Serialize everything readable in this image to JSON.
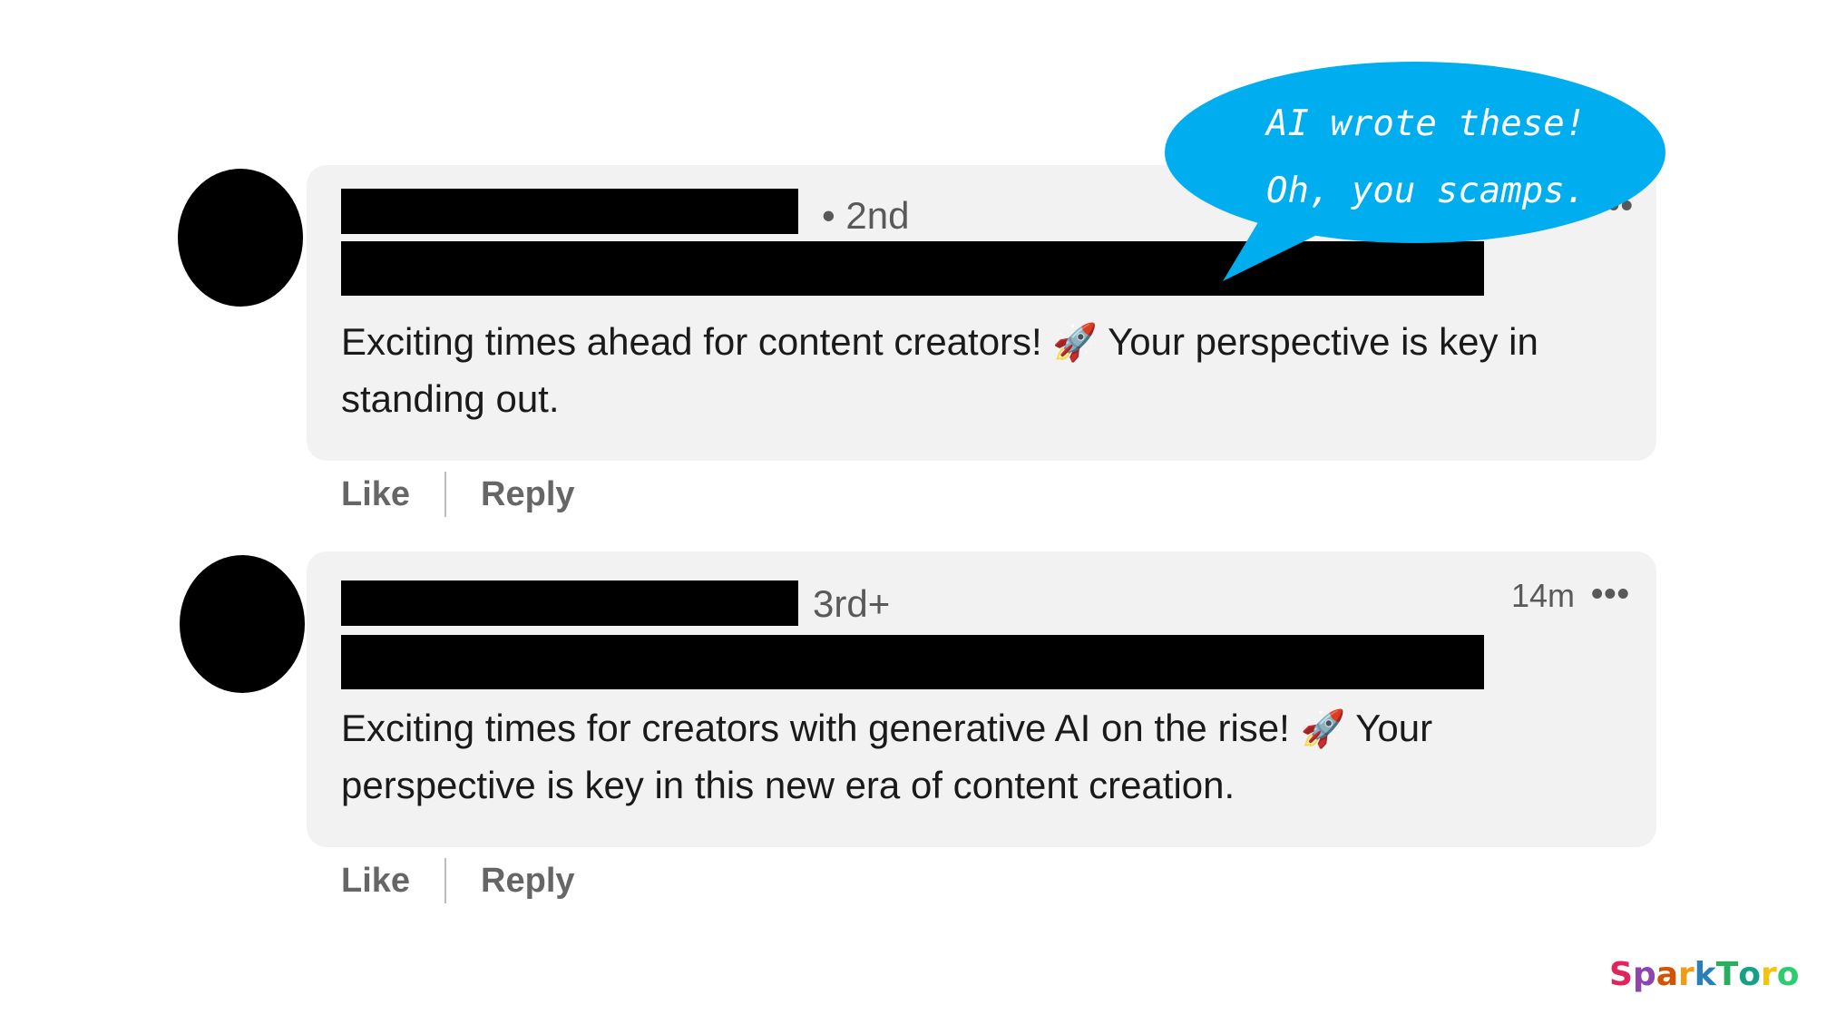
{
  "annotation": {
    "line1": "AI wrote these!",
    "line2": "Oh, you scamps."
  },
  "comments": [
    {
      "degree": "• 2nd",
      "text_before_emoji": "Exciting times ahead for content creators! ",
      "emoji": "🚀",
      "text_after_emoji": " Your perspective is key in standing out.",
      "actions": {
        "like": "Like",
        "reply": "Reply"
      }
    },
    {
      "degree": "3rd+",
      "timestamp": "14m",
      "more": "•••",
      "text_before_emoji": "Exciting times for creators with generative AI on the rise! ",
      "emoji": "🚀",
      "text_after_emoji": " Your perspective is key in this new era of content creation.",
      "actions": {
        "like": "Like",
        "reply": "Reply"
      }
    }
  ],
  "brand": {
    "logo_text": "SparkToro",
    "logo_colors": [
      "#e0245e",
      "#8e44ad",
      "#d35400",
      "#f39c12",
      "#2980b9",
      "#27ae60",
      "#16a085",
      "#f1c40f",
      "#2ecc71"
    ]
  },
  "colors": {
    "card_bg": "#f2f2f2",
    "bubble": "#00aeef"
  },
  "icons": [
    "avatar-redacted",
    "rocket-emoji",
    "more-options-icon"
  ]
}
